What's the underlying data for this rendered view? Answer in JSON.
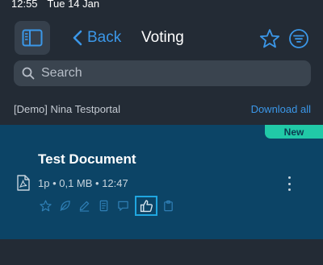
{
  "status_bar": {
    "time": "12:55",
    "date": "Tue 14 Jan"
  },
  "nav": {
    "back_label": "Back",
    "title": "Voting",
    "icons": [
      "sidebar-icon",
      "chevron-left-icon",
      "star-icon",
      "filter-icon"
    ]
  },
  "search": {
    "placeholder": "Search"
  },
  "portal": {
    "name": "[Demo] Nina Testportal",
    "download_all": "Download all"
  },
  "document": {
    "badge": "New",
    "title": "Test Document",
    "meta": "1p • 0,1 MB • 12:47",
    "file_type_icon": "pdf-icon",
    "actions": [
      "star-icon",
      "leaf-icon",
      "pencil-icon",
      "document-icon",
      "comment-icon",
      "thumbs-up-icon",
      "clipboard-icon"
    ],
    "selected_action": "thumbs-up-icon"
  },
  "colors": {
    "background": "#232b35",
    "accent": "#3b97e8",
    "card": "#0c4466",
    "badge": "#21c9a7"
  }
}
